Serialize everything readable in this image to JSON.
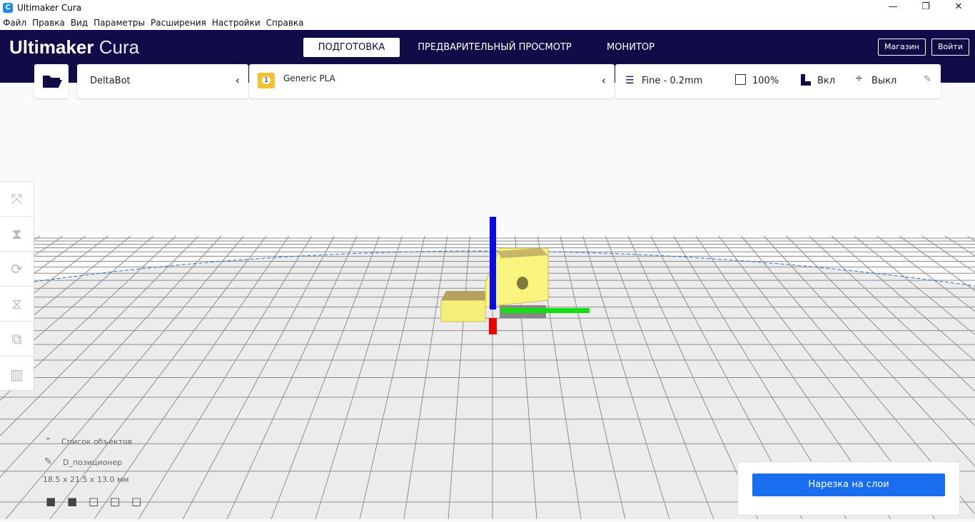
{
  "window": {
    "title": "Ultimaker Cura",
    "minimize": "—",
    "restore": "❐",
    "close": "✕"
  },
  "menu": [
    "Файл",
    "Правка",
    "Вид",
    "Параметры",
    "Расширения",
    "Настройки",
    "Справка"
  ],
  "header": {
    "brand_bold": "Ultimaker",
    "brand_light": "Cura",
    "stages": [
      "ПОДГОТОВКА",
      "ПРЕДВАРИТЕЛЬНЫЙ ПРОСМОТР",
      "МОНИТОР"
    ],
    "marketplace": "Магазин",
    "login": "Войти"
  },
  "toolbar": {
    "printer": "DeltaBot",
    "extruder_number": "1",
    "material": "Generic PLA",
    "profile": "Fine - 0.2mm",
    "infill": "100%",
    "support": "Вкл",
    "adhesion": "Выкл"
  },
  "objects": {
    "list_label": "Список объектов",
    "object_name": "D_позиционер",
    "dimensions": "18.5 x 21.5 x 13.0 мм"
  },
  "slice_button": "Нарезка на слои",
  "colors": {
    "header": "#0f0c48",
    "accent": "#196ef0",
    "model": "#f5f07a"
  }
}
